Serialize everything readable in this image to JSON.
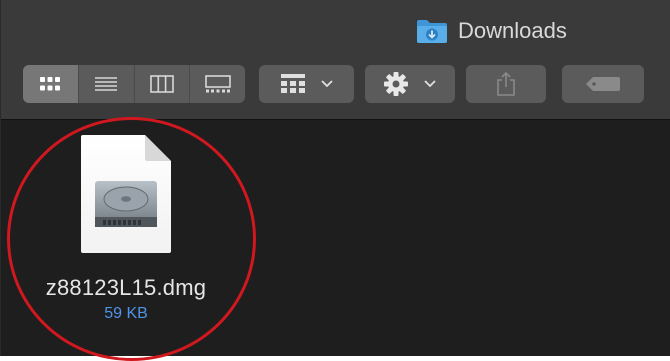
{
  "window": {
    "title": "Downloads",
    "title_icon": "folder-downloads-icon"
  },
  "toolbar": {
    "view_buttons": [
      {
        "name": "icon-view",
        "icon": "grid-icon",
        "active": true
      },
      {
        "name": "list-view",
        "icon": "list-icon",
        "active": false
      },
      {
        "name": "column-view",
        "icon": "columns-icon",
        "active": false
      },
      {
        "name": "gallery-view",
        "icon": "gallery-icon",
        "active": false
      }
    ],
    "group_button": {
      "icon": "group-icon",
      "has_dropdown": true
    },
    "action_button": {
      "icon": "gear-icon",
      "has_dropdown": true
    },
    "share_button": {
      "icon": "share-icon",
      "enabled": false
    },
    "tag_button": {
      "icon": "tag-icon",
      "enabled": false
    }
  },
  "files": [
    {
      "name": "z88123L15.dmg",
      "size": "59 KB",
      "icon": "disk-image-icon",
      "highlighted": true
    }
  ],
  "colors": {
    "highlight_circle": "#d0181e",
    "file_size_text": "#4e94e8",
    "toolbar_bg": "#3a3a3a",
    "content_bg": "#1e1e1e"
  }
}
